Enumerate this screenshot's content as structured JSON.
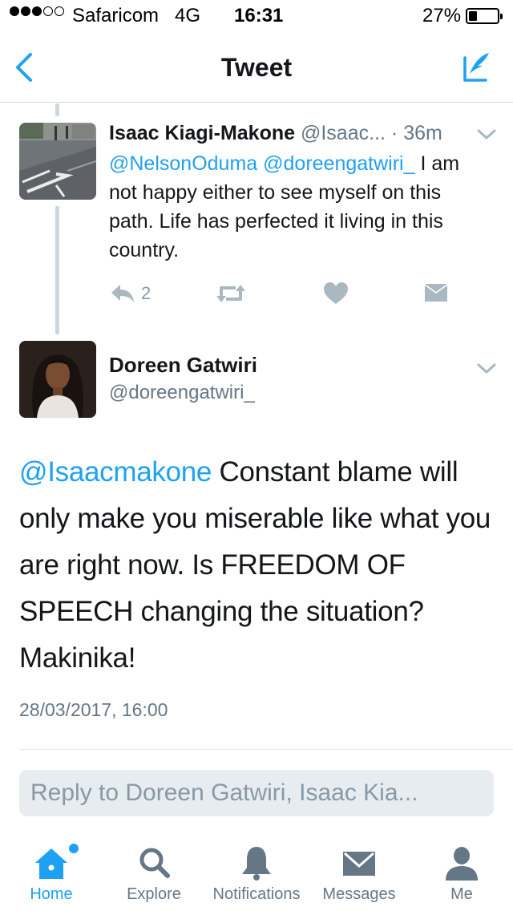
{
  "status_bar": {
    "carrier": "Safaricom",
    "network": "4G",
    "time": "16:31",
    "battery_percent": "27%",
    "signal_bars_filled": 3,
    "signal_bars_total": 5
  },
  "nav": {
    "title": "Tweet",
    "back_icon": "chevron-left-icon",
    "compose_icon": "compose-tweet-icon"
  },
  "parent_tweet": {
    "name": "Isaac Kiagi-Makone",
    "handle": "@Isaac...",
    "time": "· 36m",
    "mention_1": "@NelsonOduma",
    "mention_2": "@doreengatwiri_",
    "text": " I am not happy either to see myself on this path. Life has perfected it living in this country.",
    "reply_count": "2",
    "avatar_icon": "road-photo-avatar"
  },
  "main_tweet": {
    "name": "Doreen Gatwiri",
    "handle": "@doreengatwiri_",
    "mention": "@Isaacmakone",
    "text": " Constant blame will only make you miserable like what you are right now. Is FREEDOM OF SPEECH changing the situation? Makinika!",
    "timestamp": "28/03/2017, 16:00",
    "avatar_icon": "profile-photo-avatar"
  },
  "reply": {
    "placeholder": "Reply to Doreen Gatwiri, Isaac Kia..."
  },
  "tabs": [
    {
      "label": "Home",
      "icon": "home-icon",
      "active": true
    },
    {
      "label": "Explore",
      "icon": "search-icon",
      "active": false
    },
    {
      "label": "Notifications",
      "icon": "bell-icon",
      "active": false
    },
    {
      "label": "Messages",
      "icon": "envelope-icon",
      "active": false
    },
    {
      "label": "Me",
      "icon": "person-icon",
      "active": false
    }
  ],
  "colors": {
    "accent": "#1da1f2",
    "secondary_text": "#657786",
    "icon_gray": "#aab8c2"
  }
}
